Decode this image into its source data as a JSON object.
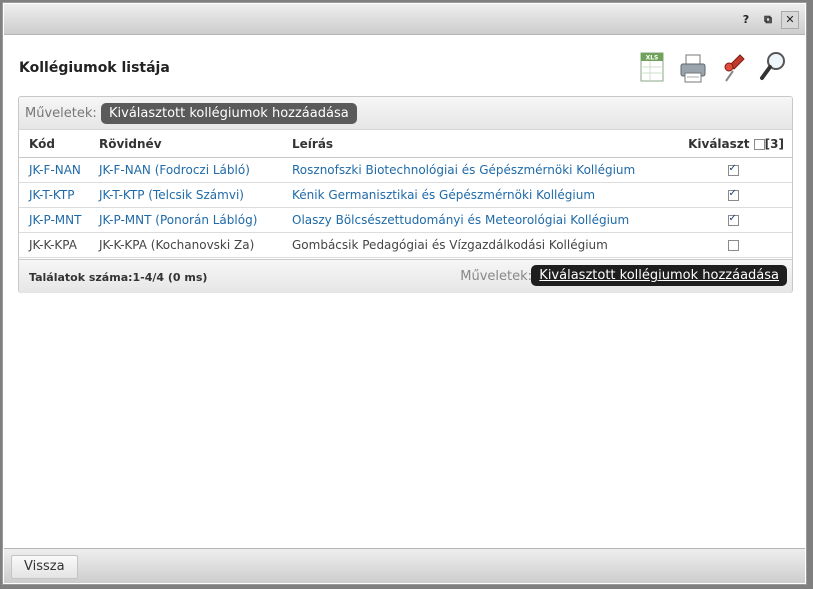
{
  "titlebar": {
    "help_label": "?",
    "popout_label": "⧉",
    "close_label": "✕"
  },
  "page_title": "Kollégiumok listája",
  "toolbar_icons": [
    "xls-export-icon",
    "print-icon",
    "pin-icon",
    "search-icon"
  ],
  "xls_label": "XLS",
  "ops_top": {
    "label": "Műveletek:",
    "button": "Kiválasztott kollégiumok hozzáadása"
  },
  "table": {
    "headers": {
      "kod": "Kód",
      "rovidnev": "Rövidnév",
      "leiras": "Leírás",
      "kivalaszt": "Kiválaszt",
      "selected_count": "[3]"
    },
    "rows": [
      {
        "kod": "JK-F-NAN",
        "rovidnev": "JK-F-NAN (Fodroczi Lábló)",
        "leiras": "Rosznofszki Biotechnológiai és Gépészmérnöki Kollégium",
        "checked": true,
        "linked": true
      },
      {
        "kod": "JK-T-KTP",
        "rovidnev": "JK-T-KTP (Telcsik Számvi)",
        "leiras": "Kénik Germanisztikai és Gépészmérnöki Kollégium",
        "checked": true,
        "linked": true
      },
      {
        "kod": "JK-P-MNT",
        "rovidnev": "JK-P-MNT (Ponorán Láblóg)",
        "leiras": "Olaszy Bölcsészettudományi és Meteorológiai Kollégium",
        "checked": true,
        "linked": true
      },
      {
        "kod": "JK-K-KPA",
        "rovidnev": "JK-K-KPA (Kochanovski Za)",
        "leiras": "Gombácsik Pedagógiai és Vízgazdálkodási Kollégium",
        "checked": false,
        "linked": false
      }
    ]
  },
  "ops_bottom": {
    "results": "Találatok száma:1-4/4 (0 ms)",
    "label": "Műveletek:",
    "button": "Kiválasztott kollégiumok hozzáadása"
  },
  "footer": {
    "back_button": "Vissza"
  }
}
